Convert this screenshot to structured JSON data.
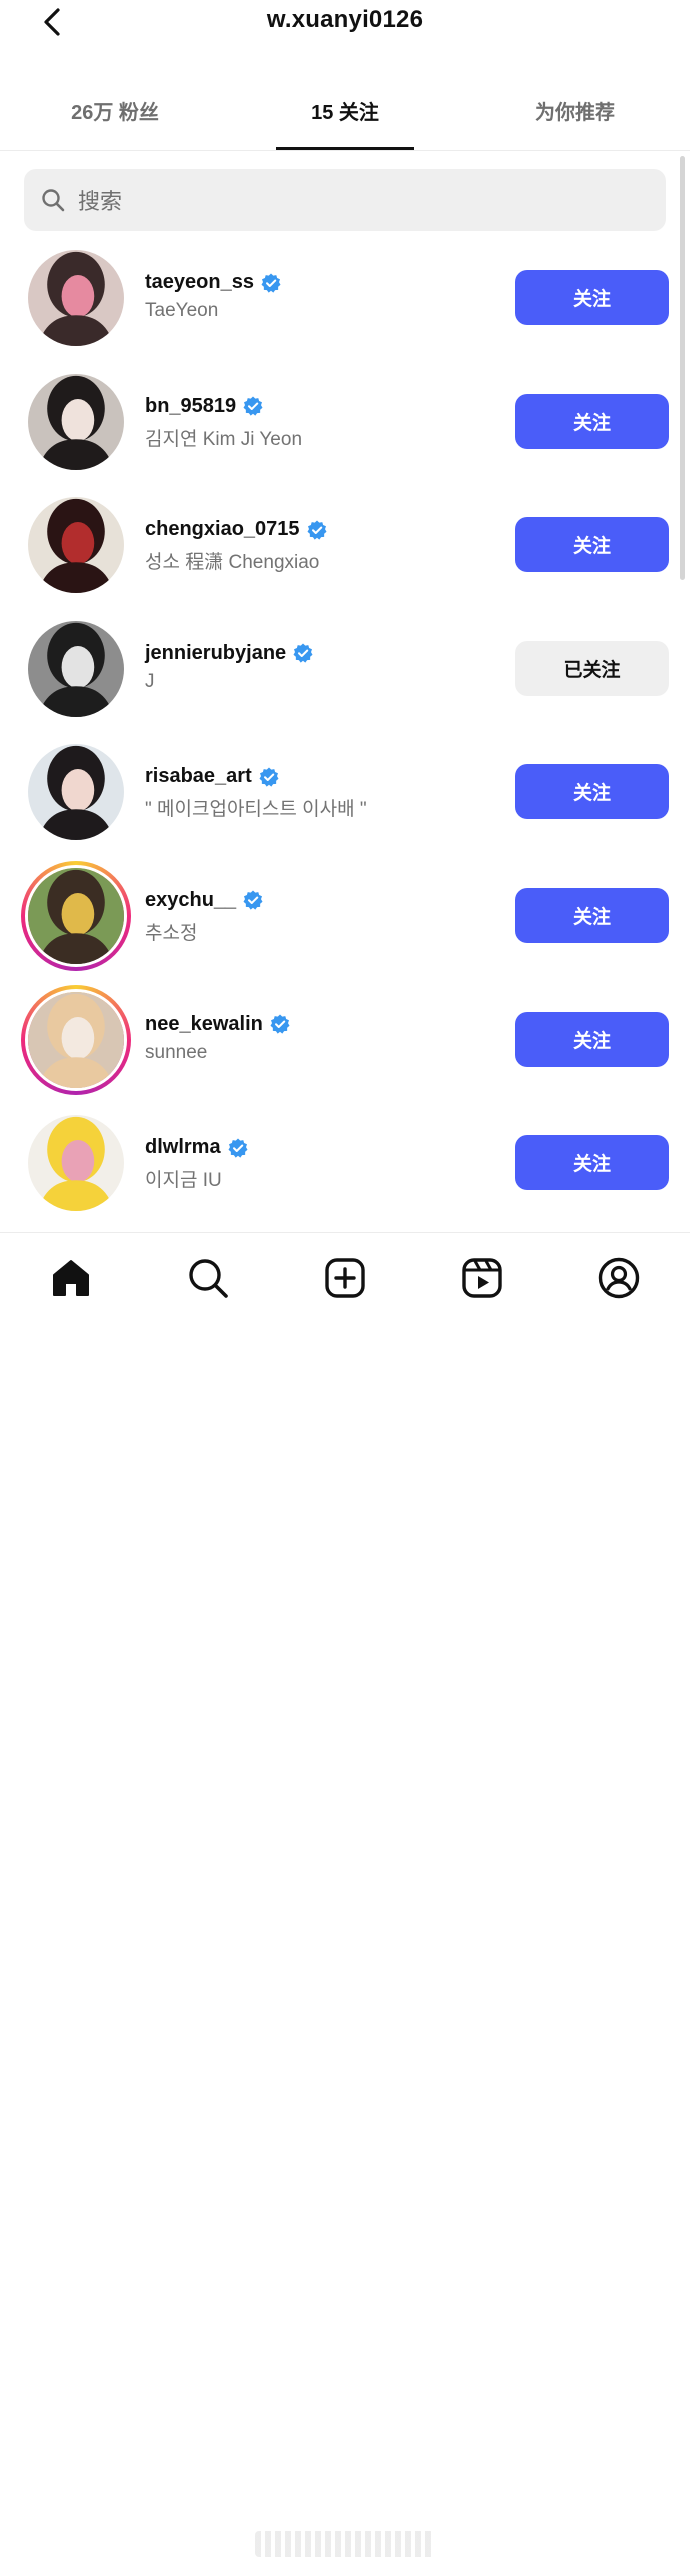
{
  "header": {
    "title": "w.xuanyi0126"
  },
  "tabs": [
    {
      "label": "26万 粉丝"
    },
    {
      "label": "15 关注"
    },
    {
      "label": "为你推荐"
    }
  ],
  "search": {
    "placeholder": "搜索"
  },
  "accounts": [
    {
      "username": "taeyeon_ss",
      "name": "TaeYeon",
      "button": "关注",
      "following": false,
      "avatar": {
        "bg": "#d9c8c4",
        "fg": "#3a2a2a",
        "accent": "#e68aa0",
        "ring": false
      }
    },
    {
      "username": "bn_95819",
      "name": "김지연 Kim Ji Yeon",
      "button": "关注",
      "following": false,
      "avatar": {
        "bg": "#c9c2bd",
        "fg": "#1f1b1b",
        "accent": "#efe2dc",
        "ring": false
      }
    },
    {
      "username": "chengxiao_0715",
      "name": "성소 程潇 Chengxiao",
      "button": "关注",
      "following": false,
      "avatar": {
        "bg": "#e7e1d8",
        "fg": "#2a1414",
        "accent": "#b22d2d",
        "ring": false
      }
    },
    {
      "username": "jennierubyjane",
      "name": "J",
      "button": "已关注",
      "following": true,
      "avatar": {
        "bg": "#8d8d8d",
        "fg": "#1d1d1d",
        "accent": "#e3e3e3",
        "ring": false
      }
    },
    {
      "username": "risabae_art",
      "name": "\" 메이크업아티스트 이사배 \"",
      "button": "关注",
      "following": false,
      "avatar": {
        "bg": "#dfe5ea",
        "fg": "#1e1a1c",
        "accent": "#f0d7cf",
        "ring": false
      }
    },
    {
      "username": "exychu__",
      "name": "추소정",
      "button": "关注",
      "following": false,
      "avatar": {
        "bg": "#7b9a56",
        "fg": "#3b2d23",
        "accent": "#e0b94a",
        "ring": true
      }
    },
    {
      "username": "nee_kewalin",
      "name": "sunnee",
      "button": "关注",
      "following": false,
      "avatar": {
        "bg": "#d8c6b4",
        "fg": "#e9c9a0",
        "accent": "#f3e9e0",
        "ring": true
      }
    },
    {
      "username": "dlwlrma",
      "name": "이지금 IU",
      "button": "关注",
      "following": false,
      "avatar": {
        "bg": "#f2efe9",
        "fg": "#f5d23a",
        "accent": "#e9a2b6",
        "ring": false
      }
    }
  ],
  "colors": {
    "primary_button": "#4a5df9",
    "verified": "#3897f0",
    "following_button": "#efefef"
  },
  "bottom_nav": [
    "home-icon",
    "search-icon",
    "create-icon",
    "reels-icon",
    "profile-icon"
  ]
}
